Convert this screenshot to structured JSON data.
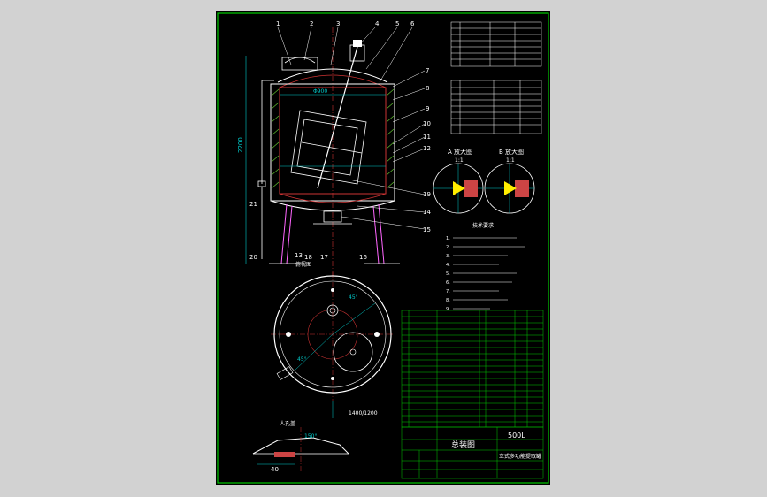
{
  "balloons": [
    "1",
    "2",
    "3",
    "4",
    "5",
    "6",
    "7",
    "8",
    "9",
    "10",
    "11",
    "12",
    "13",
    "14",
    "15",
    "16",
    "17",
    "18",
    "19",
    "20",
    "21"
  ],
  "dims": {
    "dia_inner": "Φ900",
    "height_total": "2200",
    "bolt_circle": "1400/1200"
  },
  "detail_views": {
    "a_title": "A 放大图",
    "b_title": "B 放大图",
    "scale": "1:1"
  },
  "plan_view": {
    "title": "俯视图",
    "angle_a": "45°",
    "angle_b": "45°"
  },
  "side_section": {
    "title": "人孔盖",
    "width_dim": "40",
    "angle": "150°"
  },
  "tech_req_title": "技术要求",
  "tech_req_items": [
    "1.",
    "2.",
    "3.",
    "4.",
    "5.",
    "6.",
    "7.",
    "8.",
    "9."
  ],
  "title_block": {
    "name": "总装图",
    "capacity": "500L",
    "subtitle": "立式多功能提取罐"
  },
  "colors": {
    "sheet": "#000000",
    "border": "#00cc00",
    "line": "#ffffff",
    "shell": "#cc3333",
    "dim": "#00cccc",
    "hatch": "#ff66ff",
    "weld": "#ffee00",
    "table": "#00cc00"
  }
}
